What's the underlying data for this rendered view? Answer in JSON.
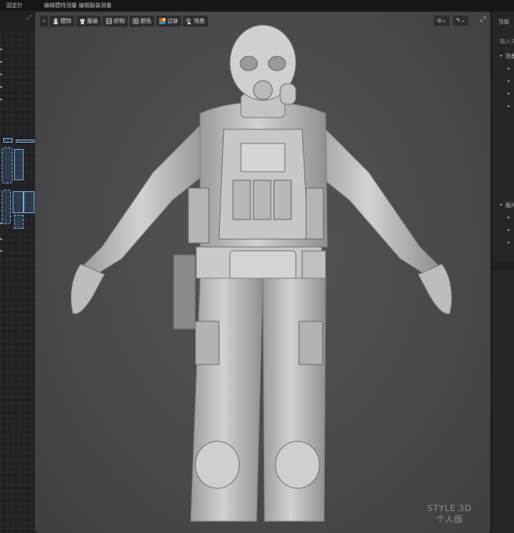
{
  "menubar": {
    "item_left": "固定针",
    "item_middle": "编辑模特测量 编辑服装测量"
  },
  "left_panel": {
    "expand_icon": "expand-icon"
  },
  "viewport": {
    "toolbar": [
      {
        "label": "模特",
        "icon": "avatar-icon"
      },
      {
        "label": "服装",
        "icon": "garment-icon"
      },
      {
        "label": "织物",
        "icon": "fabric-icon"
      },
      {
        "label": "颜色",
        "icon": "palette-icon"
      },
      {
        "label": "试穿",
        "icon": "fitting-icon"
      },
      {
        "label": "场景",
        "icon": "scene-icon"
      }
    ],
    "right_buttons": [
      {
        "icon": "camera-icon",
        "label": "◎⌄"
      },
      {
        "icon": "brush-icon",
        "label": "✎⌄"
      }
    ],
    "watermark_line1": "STYLE 3D",
    "watermark_line2": "个人版"
  },
  "right_panel": {
    "title": "当前",
    "subtitle": "输入关",
    "section1": "场景",
    "section2": "版片"
  },
  "colors": {
    "background": "#1b1b1d",
    "viewport": "#4a4a4c",
    "panel": "#262628",
    "pattern_accent": "#7fa6d6"
  }
}
